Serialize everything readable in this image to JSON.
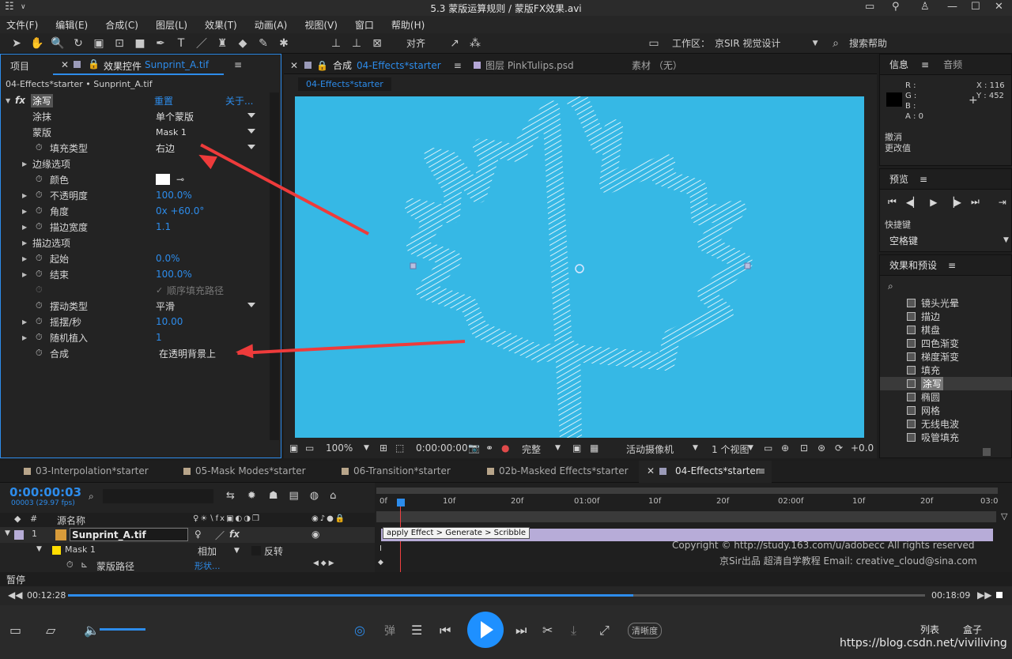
{
  "window": {
    "title": "5.3 蒙版运算规则 / 蒙版FX效果.avi"
  },
  "menu": [
    "文件(F)",
    "编辑(E)",
    "合成(C)",
    "图层(L)",
    "效果(T)",
    "动画(A)",
    "视图(V)",
    "窗口",
    "帮助(H)"
  ],
  "toolbar": {
    "align": "对齐",
    "workspace_label": "工作区：",
    "workspace_value": "京SIR 视觉设计",
    "search_help": "搜索帮助"
  },
  "project_tab": "项目",
  "effects_panel": {
    "tab_label": "效果控件",
    "tab_file": "Sunprint_A.tif",
    "breadcrumb": "04-Effects*starter • Sunprint_A.tif",
    "effect_name": "涂写",
    "reset": "重置",
    "about": "关于...",
    "props": {
      "scribble": {
        "label": "涂抹",
        "value": "单个蒙版"
      },
      "mask": {
        "label": "蒙版",
        "value": "Mask 1"
      },
      "fill_type": {
        "label": "填充类型",
        "value": "右边"
      },
      "edge_options": {
        "label": "边缘选项"
      },
      "color": {
        "label": "颜色"
      },
      "opacity": {
        "label": "不透明度",
        "value": "100.0%"
      },
      "angle": {
        "label": "角度",
        "value": "0x +60.0°"
      },
      "stroke_width": {
        "label": "描边宽度",
        "value": "1.1"
      },
      "stroke_options": {
        "label": "描边选项"
      },
      "start": {
        "label": "起始",
        "value": "0.0%"
      },
      "end": {
        "label": "结束",
        "value": "100.0%"
      },
      "sequential": {
        "label": "顺序填充路径"
      },
      "wiggle_type": {
        "label": "摆动类型",
        "value": "平滑"
      },
      "wiggles_per_sec": {
        "label": "摇摆/秒",
        "value": "10.00"
      },
      "random_seed": {
        "label": "随机植入",
        "value": "1"
      },
      "composite": {
        "label": "合成",
        "value": "在透明背景上"
      }
    }
  },
  "comp_panel": {
    "tab_label": "合成",
    "tab_comp": "04-Effects*starter",
    "tab_layer": "图层 PinkTulips.psd",
    "tab_footage": "素材 （无）",
    "sub_tab": "04-Effects*starter",
    "footer": {
      "zoom": "100%",
      "timecode": "0:00:00:00",
      "quality": "完整",
      "camera": "活动摄像机",
      "views": "1 个视图",
      "exposure": "+0.0"
    }
  },
  "info_panel": {
    "tab_info": "信息",
    "tab_audio": "音频",
    "r": "R :",
    "g": "G :",
    "b": "B :",
    "a": "A : 0",
    "x": "X : 116",
    "y": "Y : 452",
    "undo": "撤消",
    "changed": "更改值"
  },
  "preview_panel": {
    "title": "预览",
    "shortcut_label": "快捷键",
    "shortcut_value": "空格键"
  },
  "effects_presets": {
    "title": "效果和预设",
    "items": [
      "镜头光晕",
      "描边",
      "棋盘",
      "四色渐变",
      "梯度渐变",
      "填充",
      "涂写",
      "椭圆",
      "网格",
      "无线电波",
      "吸管填充"
    ],
    "selected": "涂写"
  },
  "timeline": {
    "tabs": [
      "03-Interpolation*starter",
      "05-Mask Modes*starter",
      "06-Transition*starter",
      "02b-Masked Effects*starter",
      "04-Effects*starter"
    ],
    "timecode": "0:00:00:03",
    "fps": "00003 (29.97 fps)",
    "col_number": "#",
    "col_source": "源名称",
    "layer_index": "1",
    "layer_name": "Sunprint_A.tif",
    "mask_name": "Mask 1",
    "mask_mode": "相加",
    "mask_invert": "反转",
    "mask_path": "蒙版路径",
    "mask_path_value": "形状...",
    "ruler": [
      "0f",
      "10f",
      "20f",
      "01:00f",
      "10f",
      "20f",
      "02:00f",
      "10f",
      "20f",
      "03:0"
    ],
    "tooltip": "apply Effect > Generate > Scribble",
    "copyright": "Copyright © http://study.163.com/u/adobecc All rights reserved",
    "credit": "京Sir出品  超清自学教程 Email: creative_cloud@sina.com"
  },
  "status": {
    "text": "暂停"
  },
  "player": {
    "elapsed": "00:12:28",
    "total": "00:18:09",
    "progress": 0.66,
    "danmaku": "弹",
    "clarity": "清晰度",
    "list": "列表",
    "box": "盒子",
    "watermark": "https://blog.csdn.net/viviliving"
  },
  "colors": {
    "accent": "#2d8ceb",
    "comp_bg": "#36b8e5",
    "arrow": "#ee3b3b",
    "layer_bar": "#b7acd8"
  }
}
